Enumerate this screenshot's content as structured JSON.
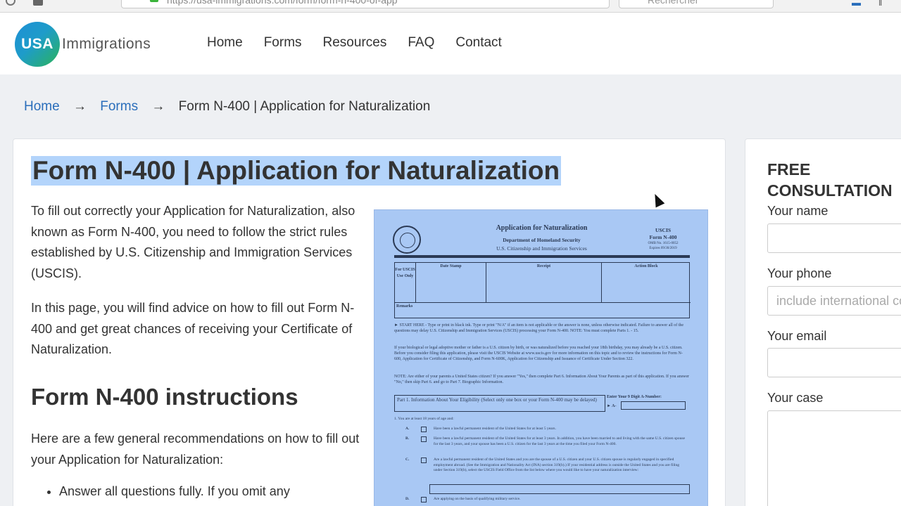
{
  "browser": {
    "url": "https://usa-immigrations.com/form/form-n-400-of-app",
    "search_placeholder": "Rechercher"
  },
  "header": {
    "logo_mark": "USA",
    "logo_word": "Immigrations",
    "nav": [
      "Home",
      "Forms",
      "Resources",
      "FAQ",
      "Contact"
    ]
  },
  "breadcrumb": {
    "home": "Home",
    "forms": "Forms",
    "separator": "→",
    "current": "Form N-400 | Application for Naturalization"
  },
  "main": {
    "title": "Form N-400 | Application for Naturalization",
    "intro_p1": "To fill out correctly your Application for Naturalization, also known as Form N-400, you need to follow the strict rules established by U.S. Citizenship and Immigration Services (USCIS).",
    "intro_p2": "In this page, you will find advice on how to fill out Form N-400 and get great chances of receiving your Certificate of Naturalization.",
    "section_title": "Form N-400 instructions",
    "section_intro": "Here are a few general recommendations on how to fill out your Application for Naturalization:",
    "bullet_1": "Answer all questions fully. If you omit any"
  },
  "form_image": {
    "title": "Application for Naturalization",
    "agency": "Department of Homeland Security",
    "agency_sub": "U.S. Citizenship and Immigration Services",
    "uscis": "USCIS",
    "form_no": "Form N-400",
    "omb": "OMB No. 1615-0052",
    "expires": "Expires 09/30/2019",
    "col_for": "For USCIS Use Only",
    "col_date": "Date Stamp",
    "col_receipt": "Receipt",
    "col_action": "Action Block",
    "remarks": "Remarks",
    "start_here": "► START HERE - Type or print in black ink. Type or print \"N/A\" if an item is not applicable or the answer is none, unless otherwise indicated. Failure to answer all of the questions may delay U.S. Citizenship and Immigration Services (USCIS) processing your Form N-400. NOTE: You must complete Parts 1. - 15.",
    "para_2": "If your biological or legal adoptive mother or father is a U.S. citizen by birth, or was naturalized before you reached your 18th birthday, you may already be a U.S. citizen. Before you consider filing this application, please visit the USCIS Website at www.uscis.gov for more information on this topic and to review the instructions for Form N-600, Application for Certificate of Citizenship, and Form N-600K, Application for Citizenship and Issuance of Certificate Under Section 322.",
    "note": "NOTE: Are either of your parents a United States citizen? If you answer \"Yes,\" then complete Part 6. Information About Your Parents as part of this application. If you answer \"No,\" then skip Part 6. and go to Part 7. Biographic Information.",
    "part1": "Part 1. Information About Your Eligibility (Select only one box or your Form N-400 may be delayed)",
    "anum_label": "Enter Your 9 Digit A-Number:",
    "anum_prefix": "► A-",
    "item_1": "1.     You are at least 18 years of age and:",
    "item_a_letter": "A.",
    "item_a": "Have been a lawful permanent resident of the United States for at least 5 years.",
    "item_b_letter": "B.",
    "item_b": "Have been a lawful permanent resident of the United States for at least 3 years. In addition, you have been married to and living with the same U.S. citizen spouse for the last 3 years, and your spouse has been a U.S. citizen for the last 3 years at the time you filed your Form N-400.",
    "item_c_letter": "C.",
    "item_c": "Are a lawful permanent resident of the United States and you are the spouse of a U.S. citizen and your U.S. citizen spouse is regularly engaged in specified employment abroad. (See the Immigration and Nationality Act (INA) section 319(b).) If your residential address is outside the United States and you are filing under Section 319(b), select the USCIS Field Office from the list below where you would like to have your naturalization interview:",
    "item_d_letter": "D.",
    "item_d": "Are applying on the basis of qualifying military service."
  },
  "sidebar": {
    "title": "FREE CONSULTATION",
    "name_label": "Your name",
    "phone_label": "Your phone",
    "phone_placeholder": "include international code",
    "email_label": "Your email",
    "case_label": "Your case"
  },
  "colors": {
    "selection": "#b3d4fb",
    "link": "#2a6ebb",
    "logo_blue": "#1f8fd6",
    "logo_green": "#2bb35a"
  }
}
